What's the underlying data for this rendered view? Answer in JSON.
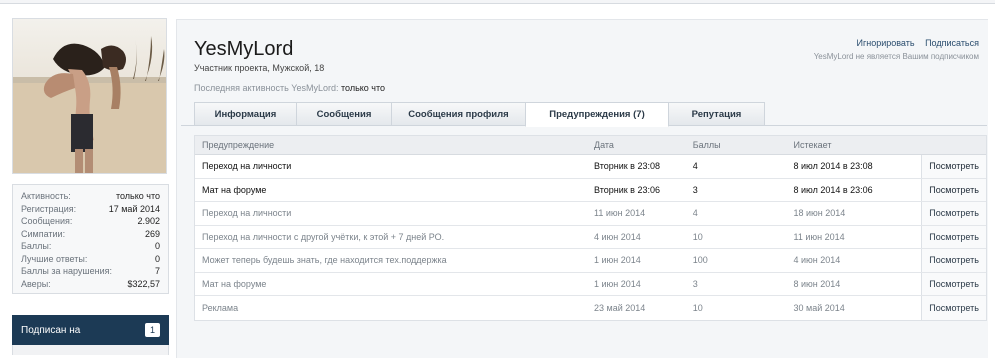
{
  "sidebar": {
    "stats": [
      {
        "label": "Активность:",
        "value": "только что"
      },
      {
        "label": "Регистрация:",
        "value": "17 май 2014"
      },
      {
        "label": "Сообщения:",
        "value": "2.902"
      },
      {
        "label": "Симпатии:",
        "value": "269"
      },
      {
        "label": "Баллы:",
        "value": "0"
      },
      {
        "label": "Лучшие ответы:",
        "value": "0"
      },
      {
        "label": "Баллы за нарушения:",
        "value": "7"
      },
      {
        "label": "Аверы:",
        "value": "$322,57"
      }
    ],
    "subscribed_label": "Подписан на",
    "subscribed_count": "1"
  },
  "profile": {
    "username": "YesMyLord",
    "info": "Участник проекта, Мужской, 18",
    "last_activity_label": "Последняя активность YesMyLord:",
    "last_activity_value": "только что"
  },
  "actions": {
    "ignore": "Игнорировать",
    "subscribe": "Подписаться",
    "note": "YesMyLord не является Вашим подписчиком"
  },
  "tabs": [
    {
      "label": "Информация"
    },
    {
      "label": "Сообщения"
    },
    {
      "label": "Сообщения профиля"
    },
    {
      "label": "Предупреждения (7)"
    },
    {
      "label": "Репутация"
    }
  ],
  "table": {
    "headers": [
      "Предупреждение",
      "Дата",
      "Баллы",
      "Истекает"
    ],
    "view_label": "Посмотреть",
    "rows": [
      {
        "warning": "Переход на личности",
        "date": "Вторник в 23:08",
        "points": "4",
        "expires": "8 июл 2014 в 23:08",
        "state": "active"
      },
      {
        "warning": "Мат на форуме",
        "date": "Вторник в 23:06",
        "points": "3",
        "expires": "8 июл 2014 в 23:06",
        "state": "active"
      },
      {
        "warning": "Переход на личности",
        "date": "11 июн 2014",
        "points": "4",
        "expires": "18 июн 2014",
        "state": "inactive"
      },
      {
        "warning": "Переход на личности с другой учётки, к этой + 7 дней РО.",
        "date": "4 июн 2014",
        "points": "10",
        "expires": "11 июн 2014",
        "state": "inactive"
      },
      {
        "warning": "Может теперь будешь знать, где находится тех.поддержка",
        "date": "1 июн 2014",
        "points": "100",
        "expires": "4 июн 2014",
        "state": "inactive"
      },
      {
        "warning": "Мат на форуме",
        "date": "1 июн 2014",
        "points": "3",
        "expires": "8 июн 2014",
        "state": "inactive"
      },
      {
        "warning": "Реклама",
        "date": "23 май 2014",
        "points": "10",
        "expires": "30 май 2014",
        "state": "inactive"
      }
    ]
  },
  "colors": {
    "accent": "#1c3a55",
    "link": "#2a4d6e"
  }
}
